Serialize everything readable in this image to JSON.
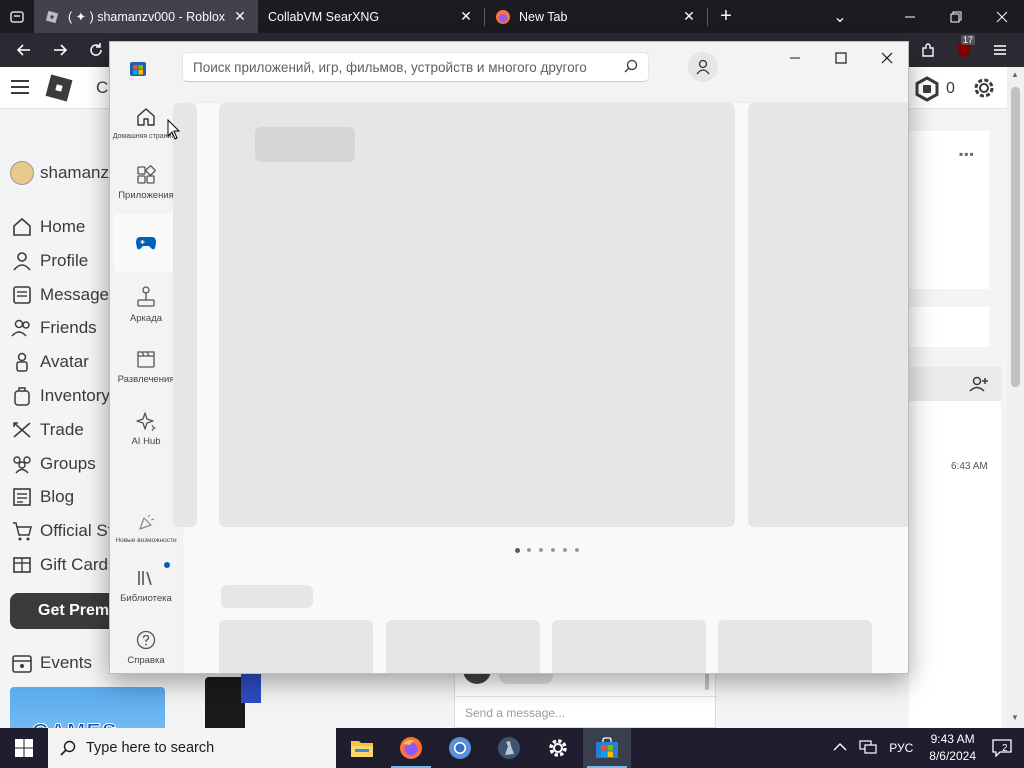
{
  "browser": {
    "tabs": [
      {
        "title": "( ✦ ) shamanzv000 - Roblox",
        "active": true
      },
      {
        "title": "CollabVM SearXNG",
        "active": false
      },
      {
        "title": "New Tab",
        "active": false
      }
    ],
    "new_tab_symbol": "+",
    "list_tabs_symbol": "⌄",
    "extension_badge": "17",
    "colors": {
      "tab_bg": "#1c1b22",
      "active_tab_bg": "#42414d",
      "toolbar_bg": "#2b2a33"
    }
  },
  "roblox": {
    "brand_partial": "C",
    "username": "shamanzv",
    "robux": "0",
    "nav_items": [
      {
        "label": "Home",
        "icon": "home-icon"
      },
      {
        "label": "Profile",
        "icon": "profile-icon"
      },
      {
        "label": "Messages",
        "icon": "messages-icon"
      },
      {
        "label": "Friends",
        "icon": "friends-icon"
      },
      {
        "label": "Avatar",
        "icon": "avatar-icon"
      },
      {
        "label": "Inventory",
        "icon": "inventory-icon"
      },
      {
        "label": "Trade",
        "icon": "trade-icon"
      },
      {
        "label": "Groups",
        "icon": "groups-icon"
      },
      {
        "label": "Blog",
        "icon": "blog-icon"
      },
      {
        "label": "Official Store",
        "icon": "store-icon"
      },
      {
        "label": "Gift Cards",
        "icon": "gift-cards-icon"
      }
    ],
    "premium_label": "Get Premium",
    "events_label": "Events",
    "games_banner_text": "GAMES",
    "chat_time": "6:43 AM",
    "chat_placeholder": "Send a message..."
  },
  "store": {
    "search_placeholder": "Поиск приложений, игр, фильмов, устройств и многого другого",
    "nav": [
      {
        "label": "Домашняя страница",
        "icon": "home-icon",
        "active": false
      },
      {
        "label": "Приложения",
        "icon": "apps-icon",
        "active": false
      },
      {
        "label": "",
        "icon": "gaming-icon",
        "active": true
      },
      {
        "label": "Аркада",
        "icon": "joystick-icon",
        "active": false
      },
      {
        "label": "Развлечения",
        "icon": "clapperboard-icon",
        "active": false
      },
      {
        "label": "AI Hub",
        "icon": "ai-hub-icon",
        "active": false
      }
    ],
    "bottom_nav": [
      {
        "label": "Новые возможности",
        "icon": "whats-new-icon"
      },
      {
        "label": "Библиотека",
        "icon": "library-icon",
        "has_update_dot": true
      },
      {
        "label": "Справка",
        "icon": "help-icon"
      }
    ],
    "carousel_dots": 6,
    "colors": {
      "accent": "#005fb8",
      "window_bg": "#f3f3f3",
      "skeleton": "#e6e6e6"
    }
  },
  "taskbar": {
    "search_placeholder": "Type here to search",
    "apps": [
      "file-explorer-icon",
      "firefox-icon",
      "chromium-icon",
      "cs-source-icon",
      "settings-icon",
      "microsoft-store-icon"
    ],
    "language": "РУС",
    "time": "9:43 AM",
    "date": "8/6/2024",
    "notification_count": "2"
  }
}
